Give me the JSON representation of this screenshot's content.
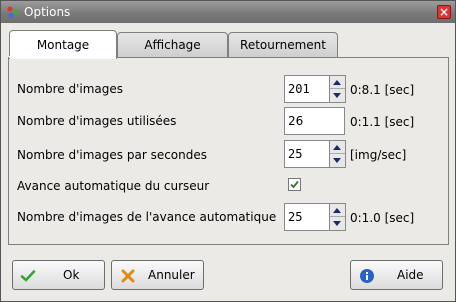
{
  "window": {
    "title": "Options"
  },
  "tabs": [
    {
      "label": "Montage",
      "active": true
    },
    {
      "label": "Affichage",
      "active": false
    },
    {
      "label": "Retournement",
      "active": false
    }
  ],
  "rows": [
    {
      "label": "Nombre d'images",
      "value": "201",
      "suffix": "0:8.1 [sec]",
      "spinner": true
    },
    {
      "label": "Nombre d'images utilisées",
      "value": "26",
      "suffix": "0:1.1 [sec]",
      "spinner": false
    },
    {
      "label": "Nombre d'images par secondes",
      "value": "25",
      "suffix": "[img/sec]",
      "spinner": true
    },
    {
      "label": "Avance automatique du curseur",
      "checked": true
    },
    {
      "label": "Nombre d'images de l'avance automatique",
      "value": "25",
      "suffix": "0:1.0 [sec]",
      "spinner": true
    }
  ],
  "buttons": {
    "ok": "Ok",
    "cancel": "Annuler",
    "help": "Aide"
  },
  "colors": {
    "ok_icon": "#3aa03a",
    "cancel_icon": "#e08a1a",
    "help_icon": "#2a62c4",
    "check": "#2d7a2d"
  }
}
